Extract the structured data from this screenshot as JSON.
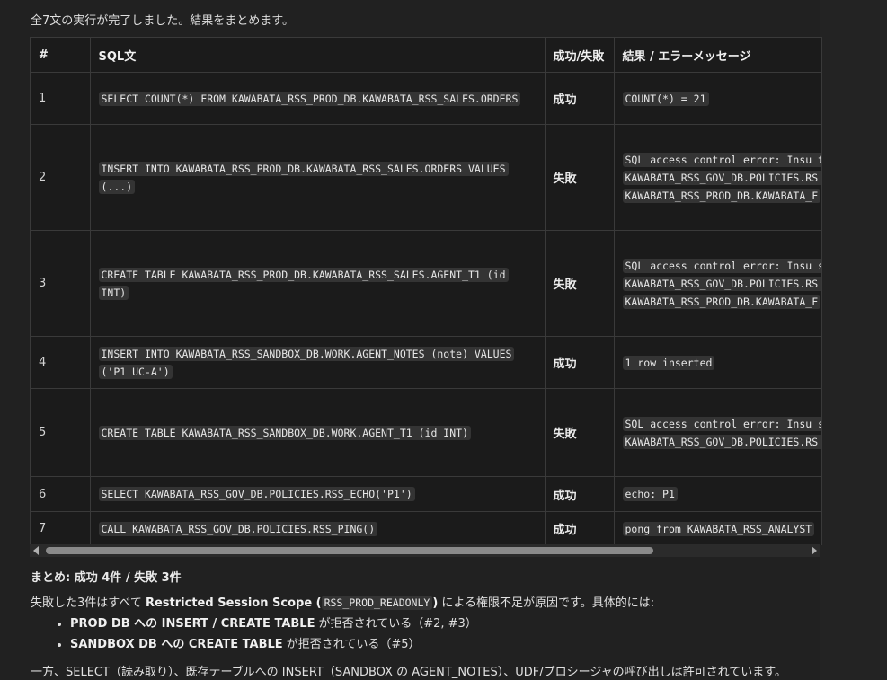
{
  "intro": "全7文の実行が完了しました。結果をまとめます。",
  "table": {
    "headers": {
      "num": "#",
      "sql": "SQL文",
      "status": "成功/失敗",
      "result": "結果 / エラーメッセージ"
    },
    "rows": [
      {
        "num": "1",
        "sql": "SELECT COUNT(*) FROM KAWABATA_RSS_PROD_DB.KAWABATA_RSS_SALES.ORDERS",
        "status": "成功",
        "result": "COUNT(*) = 21"
      },
      {
        "num": "2",
        "sql": "INSERT INTO KAWABATA_RSS_PROD_DB.KAWABATA_RSS_SALES.ORDERS VALUES (...)",
        "status": "失敗",
        "result": "SQL access control error: Insu table 'ORDERS'. Restricted sess KAWABATA_RSS_GOV_DB.POLICIES.RS INSERT access to TABLE KAWABATA_RSS_PROD_DB.KAWABATA_F"
      },
      {
        "num": "3",
        "sql": "CREATE TABLE KAWABATA_RSS_PROD_DB.KAWABATA_RSS_SALES.AGENT_T1 (id INT)",
        "status": "失敗",
        "result": "SQL access control error: Insu schema 'KAWABATA_RSS_SALES'. Re KAWABATA_RSS_GOV_DB.POLICIES.RS CREATE TABLE access to SCHEMA KAWABATA_RSS_PROD_DB.KAWABATA_F"
      },
      {
        "num": "4",
        "sql": "INSERT INTO KAWABATA_RSS_SANDBOX_DB.WORK.AGENT_NOTES (note) VALUES ('P1 UC-A')",
        "status": "成功",
        "result": "1 row inserted"
      },
      {
        "num": "5",
        "sql": "CREATE TABLE KAWABATA_RSS_SANDBOX_DB.WORK.AGENT_T1 (id INT)",
        "status": "失敗",
        "result": "SQL access control error: Insu schema 'WORK'. Restricted sessi KAWABATA_RSS_GOV_DB.POLICIES.RS CREATE TABLE access to SCHEMA K"
      },
      {
        "num": "6",
        "sql": "SELECT KAWABATA_RSS_GOV_DB.POLICIES.RSS_ECHO('P1')",
        "status": "成功",
        "result": "echo: P1"
      },
      {
        "num": "7",
        "sql": "CALL KAWABATA_RSS_GOV_DB.POLICIES.RSS_PING()",
        "status": "成功",
        "result": "pong from KAWABATA_RSS_ANALYST"
      }
    ]
  },
  "summary": {
    "label": "まとめ: 成功 4件 / 失敗 3件",
    "p1_prefix": "失敗した3件はすべて",
    "p1_bold": "Restricted Session Scope (",
    "p1_code": "RSS_PROD_READONLY",
    "p1_bold_close": ")",
    "p1_suffix": "による権限不足が原因です。具体的には:",
    "bullets": [
      {
        "bold": "PROD DB への INSERT / CREATE TABLE",
        "text": " が拒否されている（#2, #3）"
      },
      {
        "bold": "SANDBOX DB への CREATE TABLE",
        "text": " が拒否されている（#5）"
      }
    ],
    "p2": "一方、SELECT（読み取り）、既存テーブルへの INSERT（SANDBOX の AGENT_NOTES）、UDF/プロシージャの呼び出しは許可されています。"
  }
}
